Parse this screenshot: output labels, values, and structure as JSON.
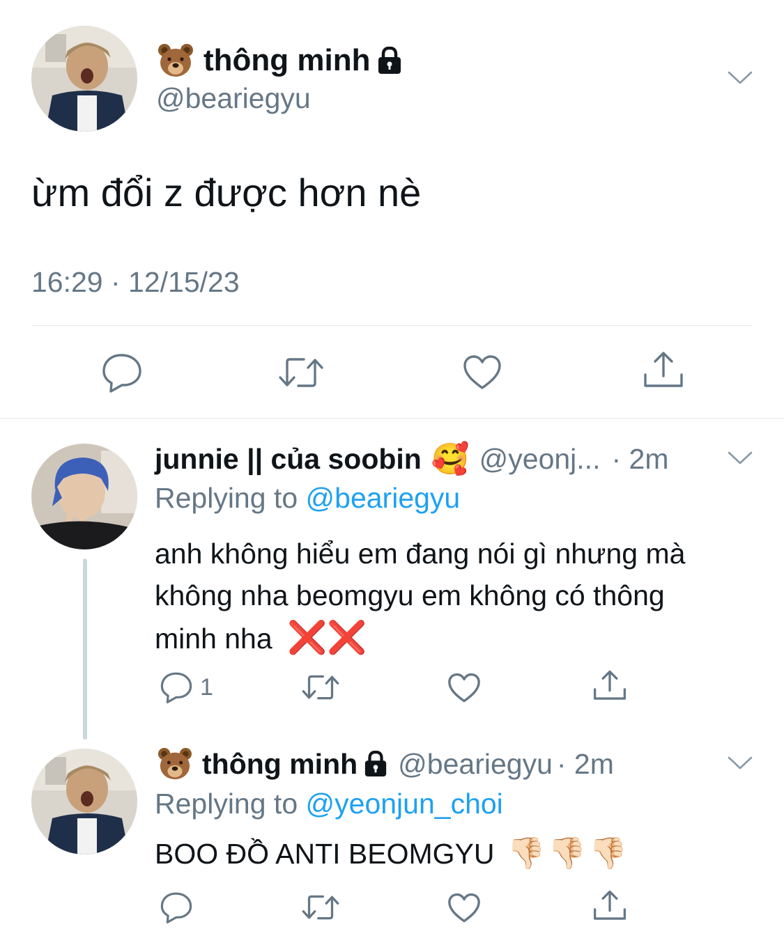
{
  "main_tweet": {
    "display_name": "thông minh",
    "handle": "@beariegyu",
    "text": "ừm đổi z được hơn nè",
    "timestamp": "16:29 · 12/15/23",
    "name_emoji_icon": "bear-face-icon",
    "protected_icon": "lock-icon"
  },
  "replies": [
    {
      "display_name": "junnie || của soobin",
      "name_emoji": "🥰",
      "handle": "@yeonj...",
      "time": "· 2m",
      "replying_label": "Replying to",
      "replying_to": "@beariegyu",
      "text_lines": [
        "anh không hiểu em đang nói gì nhưng mà",
        "không nha beomgyu em không có thông",
        "minh nha"
      ],
      "text_emoji": "❌❌",
      "reply_count": "1"
    },
    {
      "display_name": "thông minh",
      "handle": "@beariegyu",
      "time": "· 2m",
      "replying_label": "Replying to",
      "replying_to": "@yeonjun_choi",
      "text": "BOO ĐỒ ANTI BEOMGYU",
      "text_emoji": "👎🏻👎🏻👎🏻"
    }
  ],
  "colors": {
    "accent": "#1da1f2",
    "secondary_text": "#657786",
    "divider": "#e1e8ed",
    "thread_line": "#ccd6dd",
    "emoji_cross": "#dd2e44"
  }
}
